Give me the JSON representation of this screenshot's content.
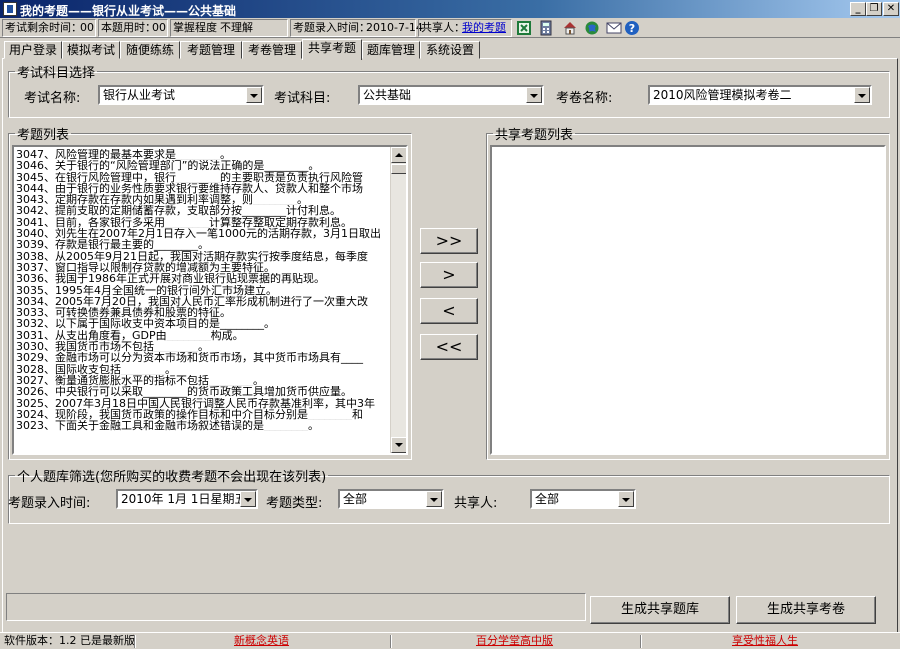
{
  "window": {
    "title": "我的考题——银行从业考试——公共基础",
    "buttons": {
      "minimize": "_",
      "restore": "❐",
      "close": "✕"
    }
  },
  "infobar": {
    "remaining_label": "考试剩余时间：",
    "remaining_value": "00",
    "used_label": "本题用时：",
    "used_value": "00",
    "mastery_label": "掌握程度",
    "mastery_value": "不理解",
    "entry_time_label": "考题录入时间：",
    "entry_time_value": "2010-7-14",
    "sharer_label": "共享人：",
    "sharer_link": "我的考题",
    "icons": [
      "excel-icon",
      "calculator-icon",
      "home-icon",
      "globe-icon",
      "email-icon",
      "help-icon"
    ]
  },
  "tabs": [
    {
      "label": "用户登录"
    },
    {
      "label": "模拟考试"
    },
    {
      "label": "随便练练"
    },
    {
      "label": "考题管理"
    },
    {
      "label": "考卷管理"
    },
    {
      "label": "共享考题",
      "active": true
    },
    {
      "label": "题库管理"
    },
    {
      "label": "系统设置"
    }
  ],
  "subject_select": {
    "legend": "考试科目选择",
    "exam_name_label": "考试名称:",
    "exam_name_value": "银行从业考试",
    "subject_label": "考试科目:",
    "subject_value": "公共基础",
    "paper_label": "考卷名称:",
    "paper_value": "2010风险管理模拟考卷二"
  },
  "question_list": {
    "legend": "考题列表",
    "items": [
      "3047、风险管理的最基本要求是________。",
      "3046、关于银行的“风险管理部门”的说法正确的是________。",
      "3045、在银行风险管理中，银行________的主要职责是负责执行风险管",
      "3044、由于银行的业务性质要求银行要维持存款人、贷款人和整个市场",
      "3043、定期存款在存款内如果遇到利率调整，则________。",
      "3042、提前支取的定期储蓄存款，支取部分按________计付利息。",
      "3041、目前，各家银行多采用________计算整存整取定期存款利息。",
      "3040、刘先生在2007年2月1日存入一笔1000元的活期存款，3月1日取出",
      "3039、存款是银行最主要的________。",
      "3038、从2005年9月21日起，我国对活期存款实行按季度结息，每季度",
      "3037、窗口指导以限制存贷款的增减额为主要特征。",
      "3036、我国于1986年正式开展对商业银行贴现票据的再贴现。",
      "3035、1995年4月全国统一的银行间外汇市场建立。",
      "3034、2005年7月20日，我国对人民币汇率形成机制进行了一次重大改",
      "3033、可转换债券兼具债券和股票的特征。",
      "3032、以下属于国际收支中资本项目的是________。",
      "3031、从支出角度看，GDP由________构成。",
      "3030、我国货币市场不包括________。",
      "3029、金融市场可以分为资本市场和货币市场，其中货币市场具有____",
      "3028、国际收支包括________。",
      "3027、衡量通货膨胀水平的指标不包括________。",
      "3026、中央银行可以采取________的货币政策工具增加货币供应量。",
      "3025、2007年3月18日中国人民银行调整人民币存款基准利率，其中3年",
      "3024、现阶段，我国货币政策的操作目标和中介目标分别是________和",
      "3023、下面关于金融工具和金融市场叙述错误的是________。"
    ]
  },
  "shared_list": {
    "legend": "共享考题列表",
    "items": []
  },
  "move_buttons": {
    "all_right": ">>",
    "right": ">",
    "left": "<",
    "all_left": "<<"
  },
  "filter": {
    "legend": "个人题库筛选(您所购买的收费考题不会出现在该列表)",
    "entry_time_label": "考题录入时间:",
    "entry_time_value": "2010年  1月  1日星期五",
    "type_label": "考题类型:",
    "type_value": "全部",
    "sharer_label": "共享人:",
    "sharer_value": "全部"
  },
  "actions": {
    "gen_bank": "生成共享题库",
    "gen_paper": "生成共享考卷"
  },
  "statusbar": {
    "version": "软件版本：1.2 已是最新版",
    "link1": "新概念英语",
    "link2": "百分学堂高中版",
    "link3": "享受性福人生"
  }
}
